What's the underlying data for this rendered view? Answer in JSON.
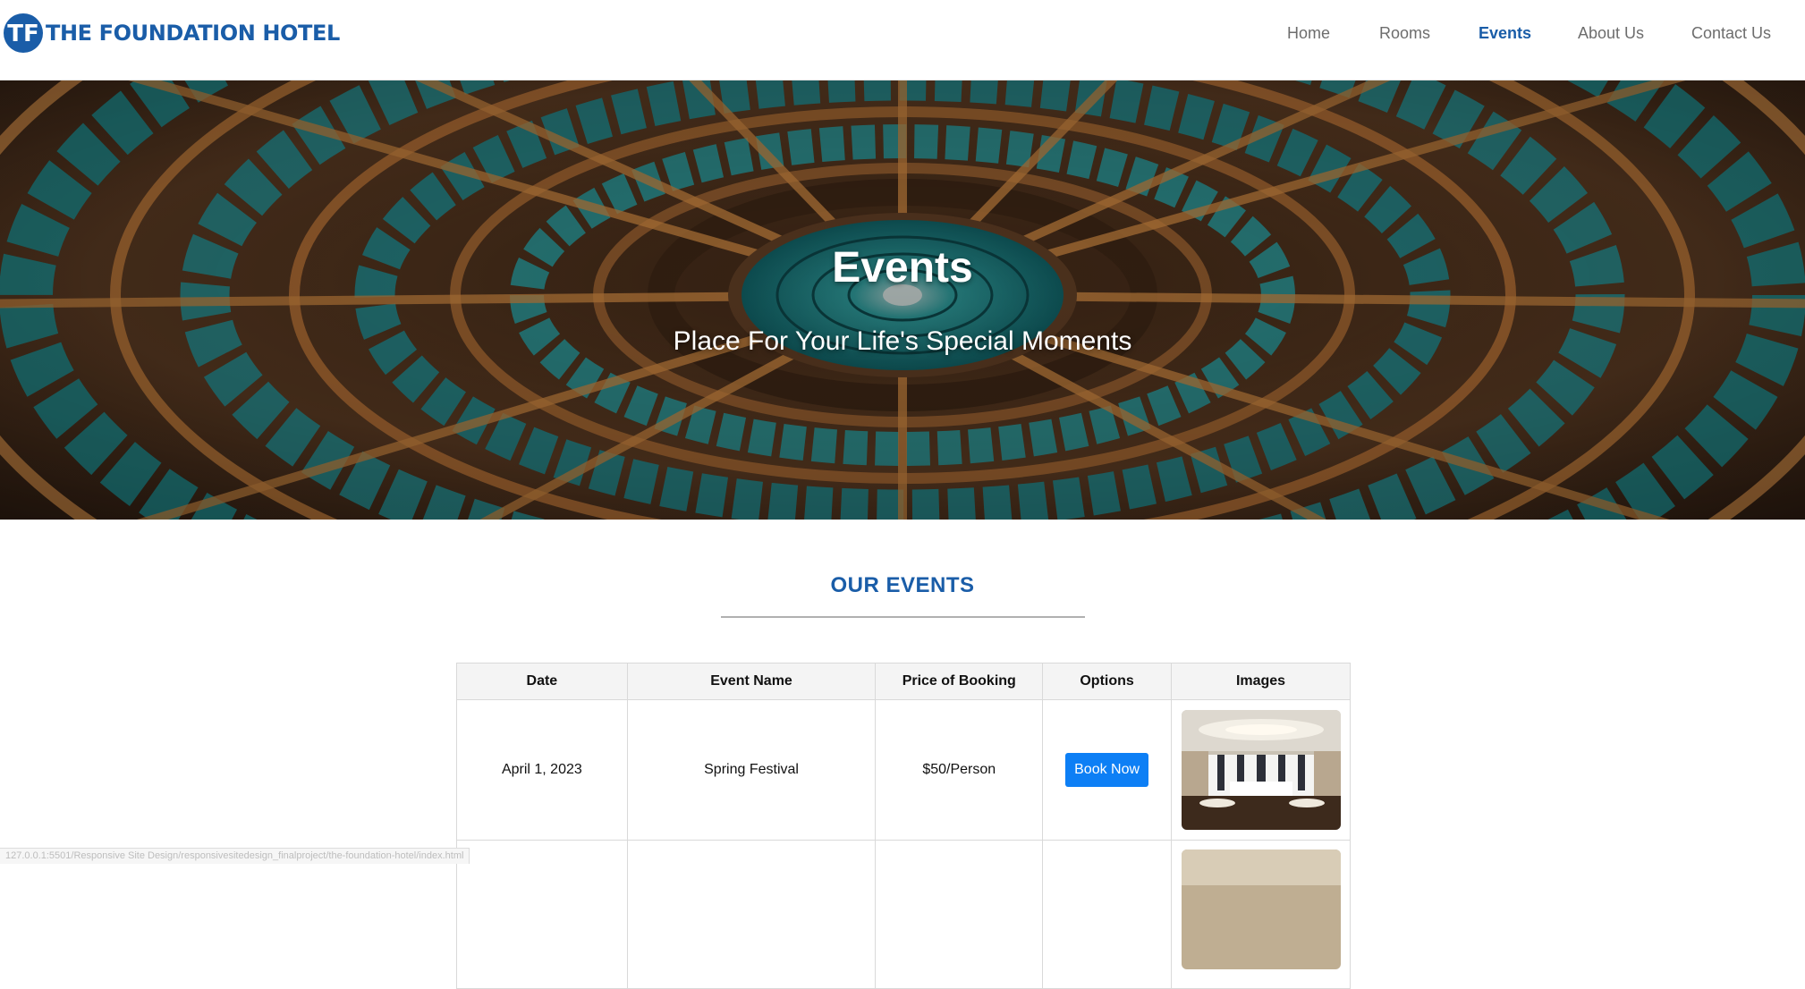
{
  "header": {
    "brand": "THE FOUNDATION HOTEL",
    "logo_letters": "TF",
    "nav": [
      {
        "label": "Home",
        "active": false
      },
      {
        "label": "Rooms",
        "active": false
      },
      {
        "label": "Events",
        "active": true
      },
      {
        "label": "About Us",
        "active": false
      },
      {
        "label": "Contact Us",
        "active": false
      }
    ]
  },
  "hero": {
    "title": "Events",
    "subtitle": "Place For Your Life's Special Moments"
  },
  "events": {
    "heading": "OUR EVENTS",
    "columns": [
      "Date",
      "Event Name",
      "Price of Booking",
      "Options",
      "Images"
    ],
    "rows": [
      {
        "date": "April 1, 2023",
        "name": "Spring Festival",
        "price": "$50/Person",
        "option": "Book Now"
      },
      {
        "date": "",
        "name": "",
        "price": "",
        "option": ""
      }
    ]
  },
  "status_bar": {
    "url": "127.0.0.1:5501/Responsive Site Design/responsivesitedesign_finalproject/the-foundation-hotel/index.html"
  },
  "colors": {
    "brand_blue": "#1a5da8",
    "button_blue": "#0d7ff5",
    "nav_gray": "#6d6d6d"
  }
}
